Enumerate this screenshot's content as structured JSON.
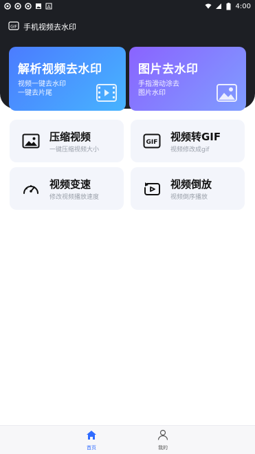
{
  "status_bar": {
    "time": "4:00"
  },
  "app": {
    "title": "手机视频去水印"
  },
  "hero_cards": [
    {
      "title": "解析视频去水印",
      "sub_lines": [
        "视频一键去水印",
        "一键去片尾"
      ]
    },
    {
      "title": "图片去水印",
      "sub_lines": [
        "手指滑动涂去",
        "图片水印"
      ]
    }
  ],
  "tiles": [
    {
      "title": "压缩视频",
      "subtitle": "一键压缩视频大小"
    },
    {
      "title": "视频转GIF",
      "subtitle": "视频修改成gif",
      "icon_text": "GIF"
    },
    {
      "title": "视频变速",
      "subtitle": "修改视频播放速度"
    },
    {
      "title": "视频倒放",
      "subtitle": "视频倒序播放"
    }
  ],
  "bottom_nav": [
    {
      "label": "首页",
      "active": true
    },
    {
      "label": "我的",
      "active": false
    }
  ],
  "colors": {
    "accent": "#3b82f6",
    "header_bg": "#1d1f24",
    "tile_bg": "#f3f5fb"
  }
}
